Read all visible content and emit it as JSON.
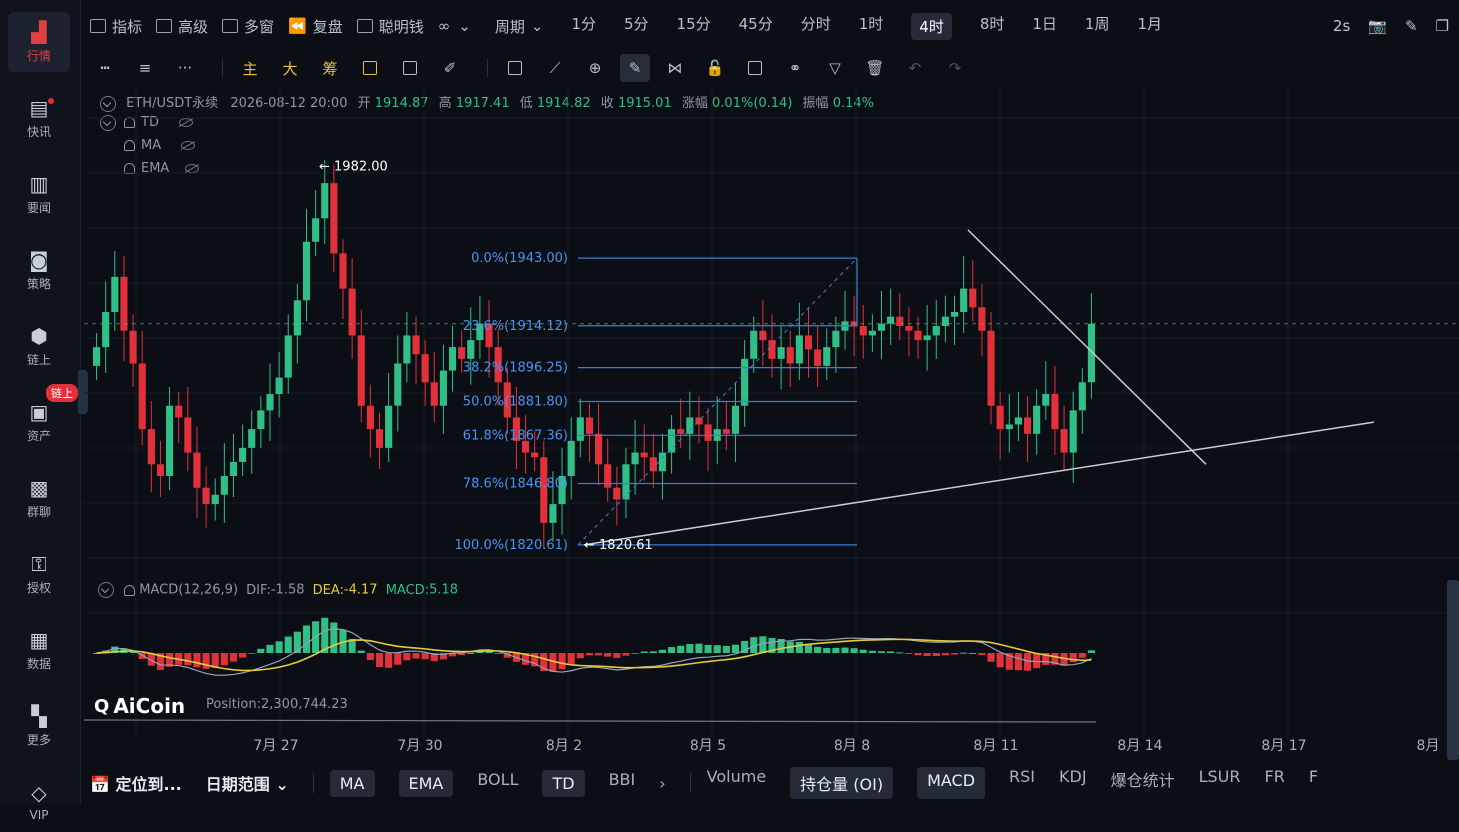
{
  "sidebar": {
    "items": [
      {
        "label": "行情",
        "icon": "bar-chart-icon",
        "active": true
      },
      {
        "label": "快讯",
        "icon": "news-icon",
        "dot": true
      },
      {
        "label": "要闻",
        "icon": "document-icon"
      },
      {
        "label": "策略",
        "icon": "robot-icon"
      },
      {
        "label": "链上",
        "icon": "chain-icon"
      },
      {
        "label": "资产",
        "icon": "wallet-icon"
      },
      {
        "label": "群聊",
        "icon": "chat-icon"
      },
      {
        "label": "授权",
        "icon": "key-icon"
      },
      {
        "label": "数据",
        "icon": "data-chart-icon"
      },
      {
        "label": "更多",
        "icon": "grid-icon"
      },
      {
        "label": "VIP",
        "icon": "diamond-icon"
      }
    ],
    "tag": "链上"
  },
  "topbar": {
    "tools": [
      "指标",
      "高级",
      "多窗",
      "复盘",
      "聪明钱"
    ],
    "period_label": "周期",
    "periods": [
      "1分",
      "5分",
      "15分",
      "45分",
      "分时",
      "1时",
      "4时",
      "8时",
      "1日",
      "1周",
      "1月"
    ],
    "active_period": "4时",
    "refresh": "2s"
  },
  "drawbar": {
    "tools": [
      "horizontal-line-icon",
      "menu-icon",
      "more-icon",
      "主",
      "大",
      "筹",
      "edit-icon",
      "copy-icon",
      "brush-icon",
      "layers-icon",
      "ruler-icon",
      "zoom-icon",
      "pen-icon",
      "magnet-icon",
      "lock-icon",
      "note-icon",
      "link-icon",
      "filter-icon",
      "trash-icon",
      "undo-icon",
      "redo-icon"
    ]
  },
  "info": {
    "symbol": "ETH/USDT永续",
    "datetime": "2026-08-12 20:00",
    "open_label": "开",
    "open": "1914.87",
    "high_label": "高",
    "high": "1917.41",
    "low_label": "低",
    "low": "1914.82",
    "close_label": "收",
    "close": "1915.01",
    "change_label": "涨幅",
    "change": "0.01%(0.14)",
    "amp_label": "振幅",
    "amp": "0.14%"
  },
  "indicators": [
    "TD",
    "MA",
    "EMA"
  ],
  "macd": {
    "title": "MACD(12,26,9)",
    "dif_label": "DIF:",
    "dif": "-1.58",
    "dea_label": "DEA:",
    "dea": "-4.17",
    "macd_label": "MACD:",
    "macd": "5.18"
  },
  "position_text": "Position:2,300,744.23",
  "logo_text": "AiCoin",
  "chart_data": {
    "type": "candlestick",
    "price_high_label": "← 1982.00",
    "price_low_label": "← 1820.61",
    "fib_levels": [
      {
        "label": "0.0%(1943.00)",
        "price": 1943.0
      },
      {
        "label": "23.6%(1914.12)",
        "price": 1914.12
      },
      {
        "label": "38.2%(1896.25)",
        "price": 1896.25
      },
      {
        "label": "50.0%(1881.80)",
        "price": 1881.8
      },
      {
        "label": "61.8%(1867.36)",
        "price": 1867.36
      },
      {
        "label": "78.6%(1846.80)",
        "price": 1846.8
      },
      {
        "label": "100.0%(1820.61)",
        "price": 1820.61
      }
    ],
    "x_labels": [
      "7月 27",
      "7月 30",
      "8月 2",
      "8月 5",
      "8月 8",
      "8月 11",
      "8月 14",
      "8月 17",
      "8月"
    ],
    "current_price": 1915.01,
    "closes": [
      1905,
      1920,
      1935,
      1912,
      1898,
      1870,
      1855,
      1850,
      1880,
      1875,
      1860,
      1845,
      1838,
      1842,
      1850,
      1856,
      1862,
      1870,
      1878,
      1885,
      1892,
      1910,
      1925,
      1950,
      1960,
      1975,
      1945,
      1930,
      1910,
      1880,
      1870,
      1862,
      1880,
      1898,
      1910,
      1902,
      1890,
      1880,
      1895,
      1905,
      1900,
      1908,
      1915,
      1905,
      1890,
      1875,
      1865,
      1860,
      1858,
      1830,
      1838,
      1850,
      1865,
      1875,
      1868,
      1855,
      1845,
      1840,
      1855,
      1860,
      1858,
      1852,
      1860,
      1870,
      1868,
      1875,
      1872,
      1865,
      1870,
      1868,
      1880,
      1900,
      1912,
      1908,
      1900,
      1905,
      1898,
      1910,
      1904,
      1897,
      1905,
      1912,
      1916,
      1914,
      1910,
      1912,
      1915,
      1918,
      1914,
      1912,
      1908,
      1910,
      1914,
      1918,
      1920,
      1930,
      1922,
      1912,
      1880,
      1870,
      1872,
      1875,
      1868,
      1880,
      1885,
      1870,
      1860,
      1878,
      1890,
      1915
    ]
  }
}
